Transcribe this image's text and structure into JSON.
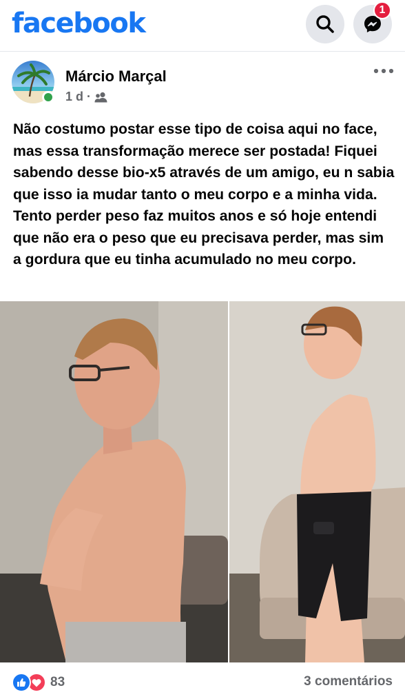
{
  "header": {
    "logo": "facebook",
    "messenger_badge": "1"
  },
  "post": {
    "author": "Márcio Marçal",
    "time": "1 d",
    "separator": "·",
    "text": "Não costumo postar esse tipo de coisa aqui no face, mas essa transformação merece ser postada! Fiquei sabendo desse bio-x5 através de um amigo, eu n sabia que isso ia mudar tanto o meu corpo e a minha vida. Tento perder peso faz muitos anos e só hoje entendi que não era o peso que eu precisava perder, mas sim a gordura que eu tinha acumulado no meu corpo."
  },
  "footer": {
    "reaction_count": "83",
    "comments": "3 comentários"
  },
  "colors": {
    "brand": "#1877f2",
    "badge": "#e41e3f",
    "online": "#31a24c",
    "love": "#f33e58",
    "secondary_text": "#65676b"
  },
  "icons": [
    "search-icon",
    "messenger-icon",
    "friends-icon",
    "more-options-icon",
    "like-reaction-icon",
    "love-reaction-icon"
  ]
}
